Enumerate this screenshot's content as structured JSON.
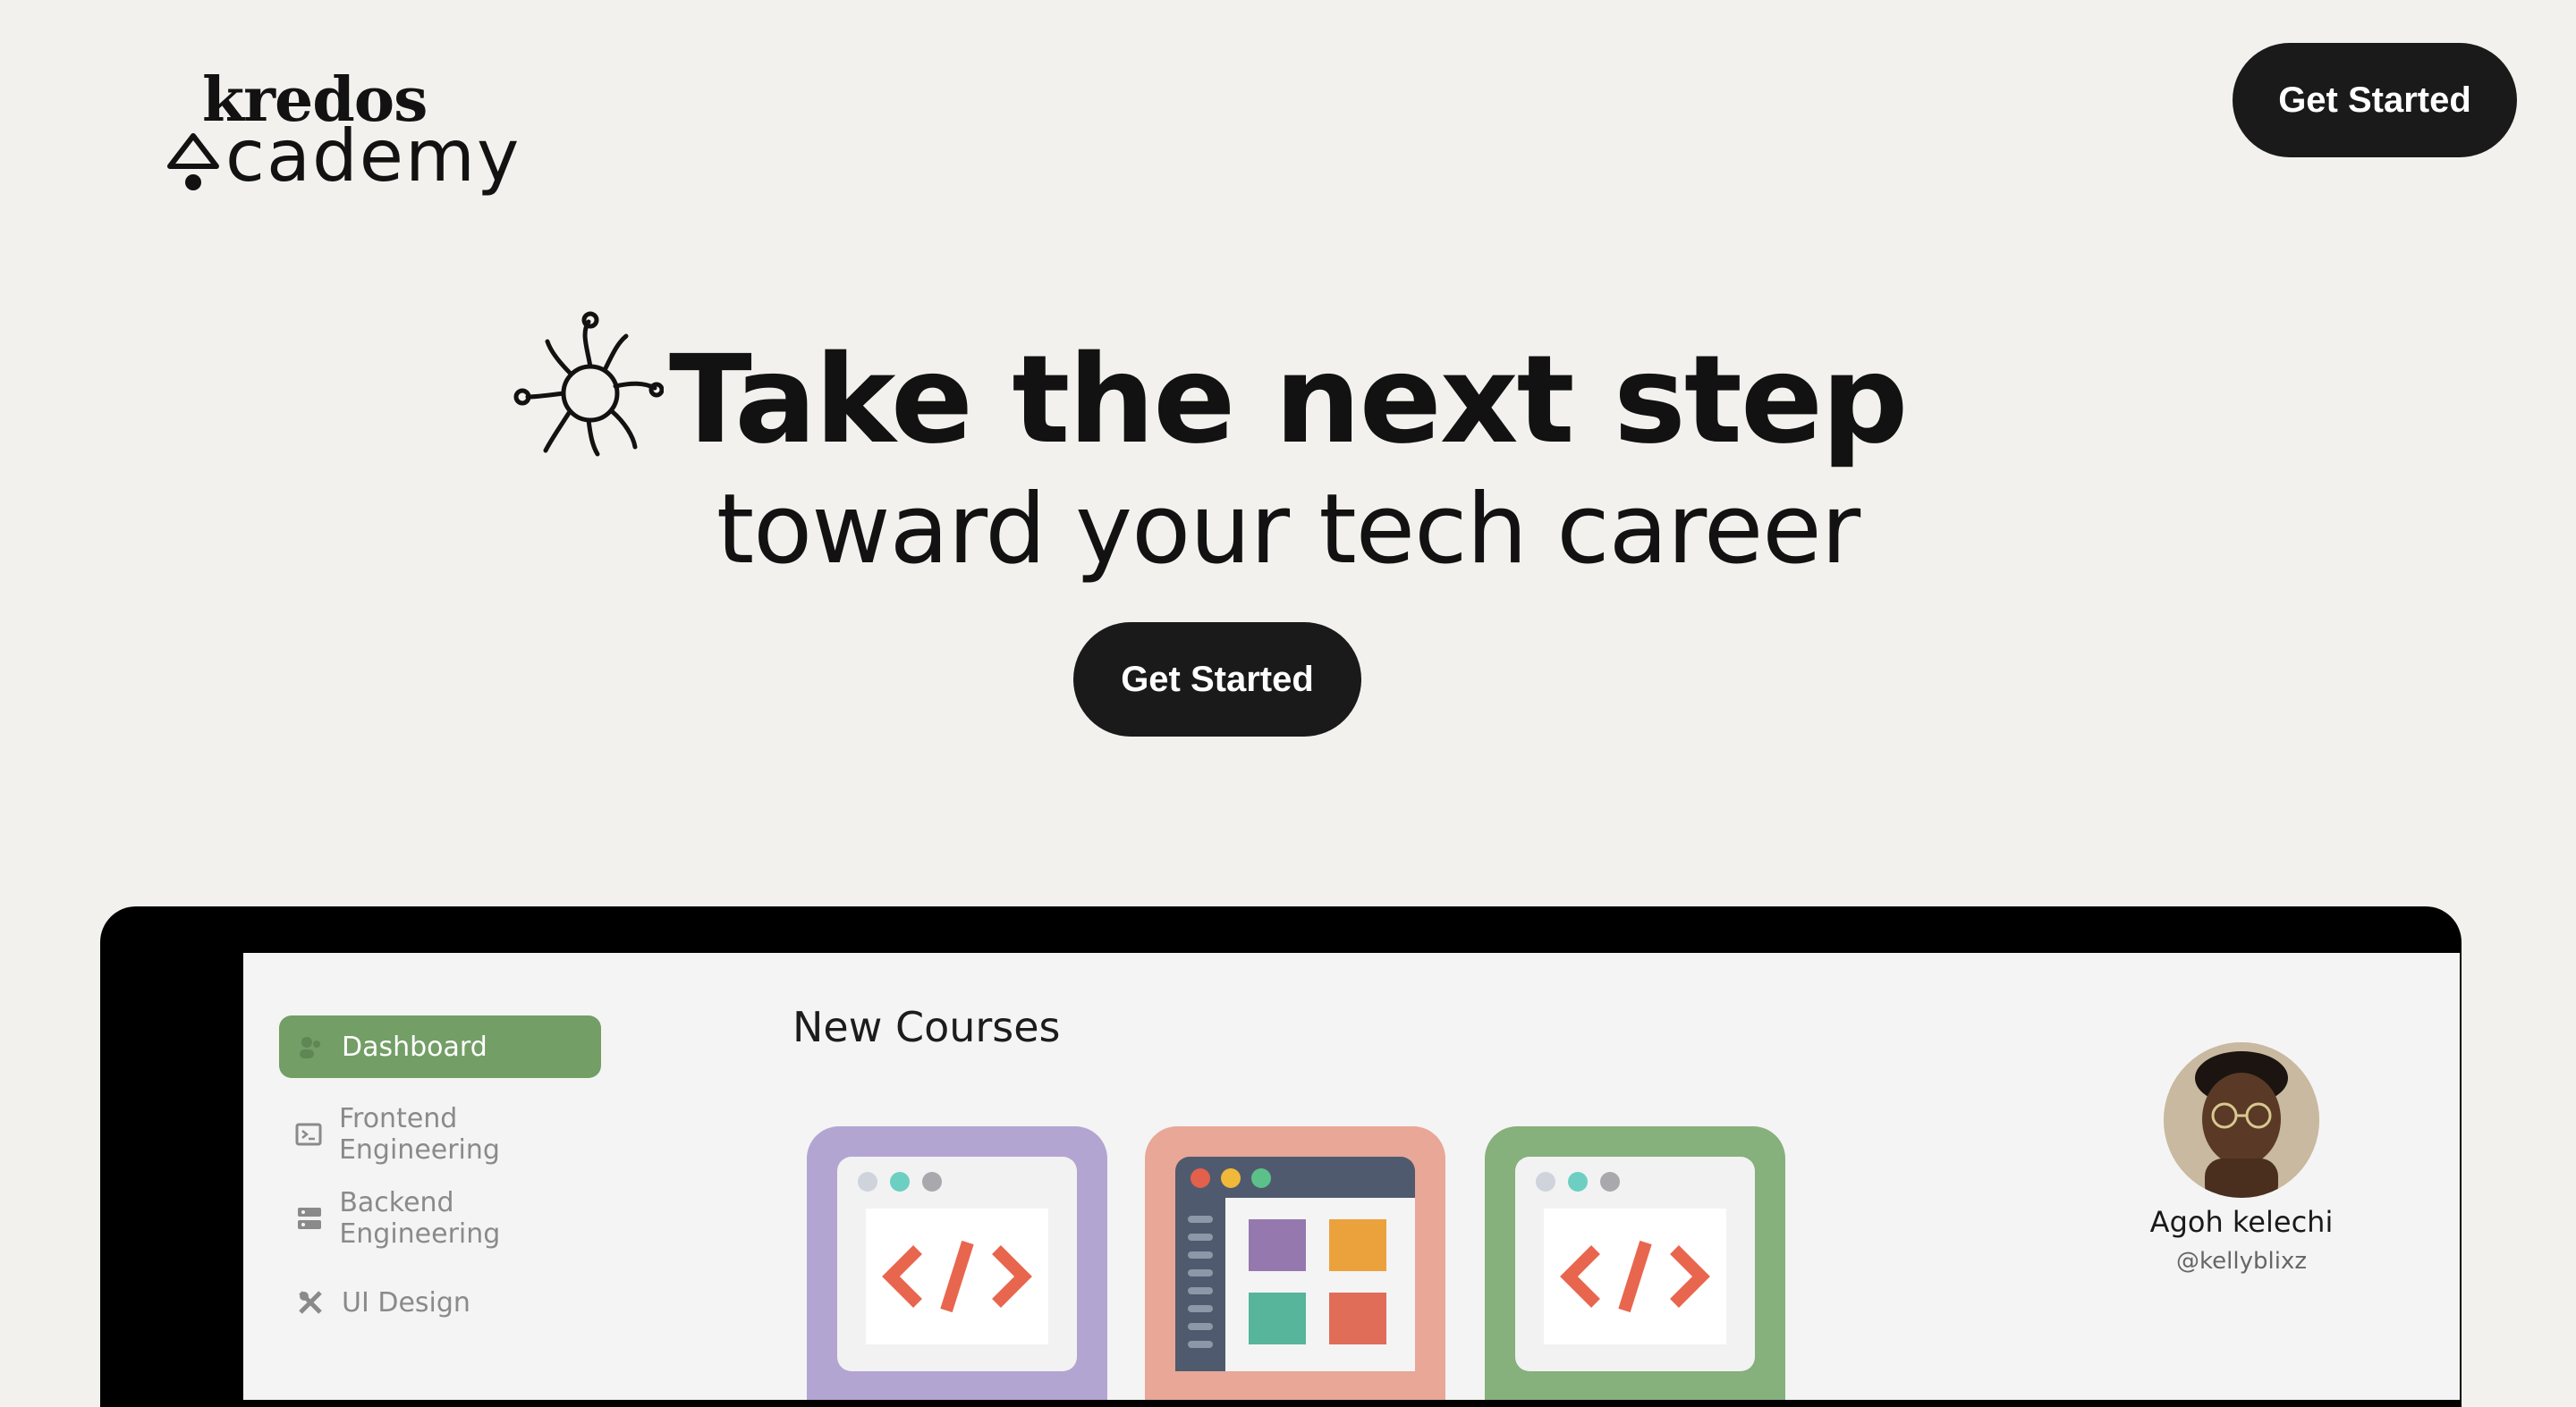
{
  "brand": {
    "line1": "kredos",
    "line2": "cademy"
  },
  "header": {
    "cta_label": "Get Started"
  },
  "hero": {
    "title": "Take the next step",
    "subtitle": "toward your tech career",
    "cta_label": "Get Started"
  },
  "dashboard": {
    "sidebar": [
      {
        "label": "Dashboard",
        "icon": "dashboard-icon",
        "active": true
      },
      {
        "label": "Frontend Engineering",
        "icon": "terminal-icon",
        "active": false
      },
      {
        "label": "Backend Engineering",
        "icon": "server-icon",
        "active": false
      },
      {
        "label": "UI Design",
        "icon": "design-tools-icon",
        "active": false
      }
    ],
    "section_title": "New Courses",
    "courses": [
      {
        "icon": "code-window-icon",
        "color": "#b3a5d2"
      },
      {
        "icon": "layout-window-icon",
        "color": "#e9a797"
      },
      {
        "icon": "code-window-icon",
        "color": "#86b07c"
      }
    ],
    "profile": {
      "name": "Agoh kelechi",
      "handle": "@kellyblixz"
    }
  },
  "colors": {
    "background": "#f3f1ed",
    "button": "#1a1a1a",
    "accent_green": "#739e66",
    "code_orange": "#e8664e"
  }
}
